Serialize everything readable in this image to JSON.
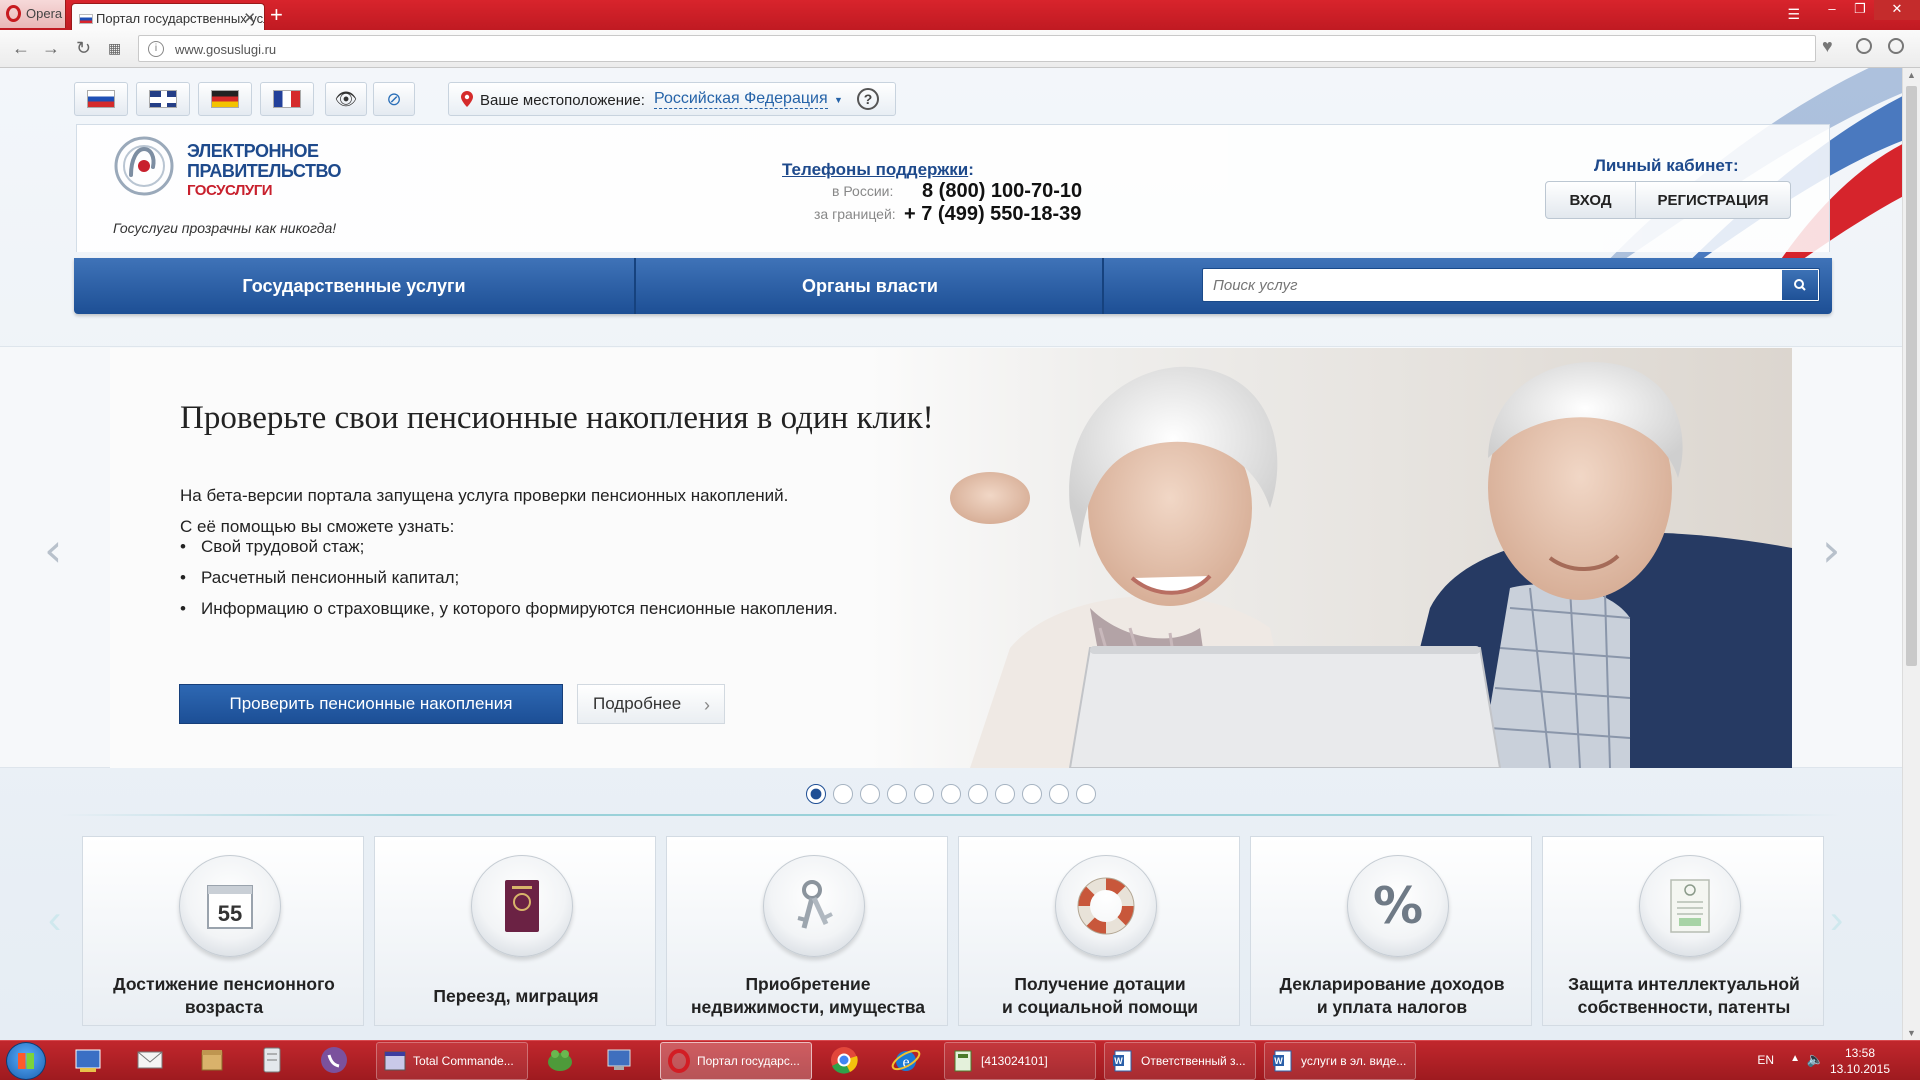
{
  "browser": {
    "menu_label": "Opera",
    "tab_title": "Портал государственных услуг",
    "new_tab": "+",
    "url": "www.gosuslugi.ru"
  },
  "header": {
    "languages": [
      "ru",
      "en",
      "de",
      "fr"
    ],
    "location_label": "Ваше местоположение:",
    "location_value": "Российская Федерация",
    "help": "?",
    "logo": {
      "line1": "ЭЛЕКТРОННОЕ",
      "line2": "ПРАВИТЕЛЬСТВО",
      "line3": "ГОСУСЛУГИ"
    },
    "slogan": "Госуслуги прозрачны как никогда!",
    "phones_title": "Телефоны поддержки",
    "phones_colon": ":",
    "phone_russia_label": "в России:",
    "phone_russia": "8 (800) 100-70-10",
    "phone_abroad_label": "за границей:",
    "phone_abroad": "+ 7 (499) 550-18-39",
    "cabinet_title": "Личный кабинет:",
    "login": "ВХОД",
    "register": "РЕГИСТРАЦИЯ"
  },
  "nav": {
    "services": "Государственные услуги",
    "authorities": "Органы власти",
    "search_placeholder": "Поиск услуг"
  },
  "banner": {
    "title": "Проверьте свои пенсионные накопления в один клик!",
    "intro_1": "На бета-версии портала запущена услуга проверки пенсионных накоплений.",
    "intro_2": "С её помощью вы сможете узнать:",
    "bullets": [
      "Свой трудовой стаж;",
      "Расчетный пенсионный капитал;",
      "Информацию о страховщике, у которого формируются пенсионные накопления."
    ],
    "primary_button": "Проверить пенсионные накопления",
    "more_button": "Подробнее",
    "slide_count": 11,
    "active_slide": 1
  },
  "categories": [
    {
      "line1": "Достижение пенсионного",
      "line2": "возраста",
      "icon": "calendar-icon",
      "badge": "55"
    },
    {
      "line1": "Переезд, миграция",
      "line2": "",
      "icon": "passport-icon"
    },
    {
      "line1": "Приобретение",
      "line2": "недвижимости, имущества",
      "icon": "keys-icon"
    },
    {
      "line1": "Получение дотации",
      "line2": "и социальной помощи",
      "icon": "lifebuoy-icon"
    },
    {
      "line1": "Декларирование доходов",
      "line2": "и уплата налогов",
      "icon": "percent-icon",
      "badge": "%"
    },
    {
      "line1": "Защита интеллектуальной",
      "line2": "собственности, патенты",
      "icon": "certificate-icon"
    }
  ],
  "taskbar": {
    "items": [
      {
        "label": "Total Commande..."
      },
      {
        "label": "Портал государс..."
      },
      {
        "label": "[413024101]"
      },
      {
        "label": "Ответственный з..."
      },
      {
        "label": "услуги в эл. виде..."
      }
    ],
    "lang": "EN",
    "time": "13:58",
    "date": "13.10.2015"
  },
  "colors": {
    "brand_blue": "#1e4a8c",
    "brand_red": "#c8202d",
    "nav_blue": "#2a5ea6",
    "taskbar_red": "#b01f25"
  }
}
